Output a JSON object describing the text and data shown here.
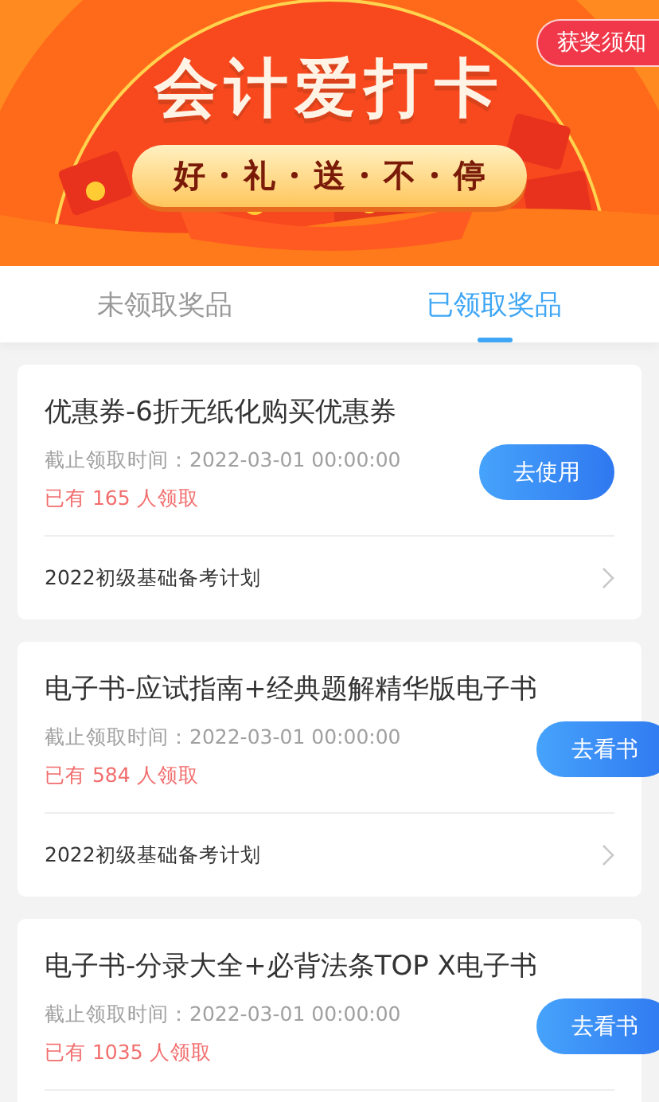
{
  "banner": {
    "title": "会计爱打卡",
    "slogan": [
      "好",
      "礼",
      "送",
      "不",
      "停"
    ],
    "notice_button": "获奖须知"
  },
  "tabs": [
    {
      "label": "未领取奖品",
      "selected": false
    },
    {
      "label": "已领取奖品",
      "selected": true
    }
  ],
  "prizes": [
    {
      "title": "优惠券-6折无纸化购买优惠券",
      "deadline": "截止领取时间：2022-03-01 00:00:00",
      "claimed": "已有 165 人领取",
      "action": "去使用",
      "plan": "2022初级基础备考计划"
    },
    {
      "title": "电子书-应试指南+经典题解精华版电子书",
      "deadline": "截止领取时间：2022-03-01 00:00:00",
      "claimed": "已有 584 人领取",
      "action": "去看书",
      "plan": "2022初级基础备考计划"
    },
    {
      "title": "电子书-分录大全+必背法条TOP X电子书",
      "deadline": "截止领取时间：2022-03-01 00:00:00",
      "claimed": "已有 1035 人领取",
      "action": "去看书"
    }
  ]
}
